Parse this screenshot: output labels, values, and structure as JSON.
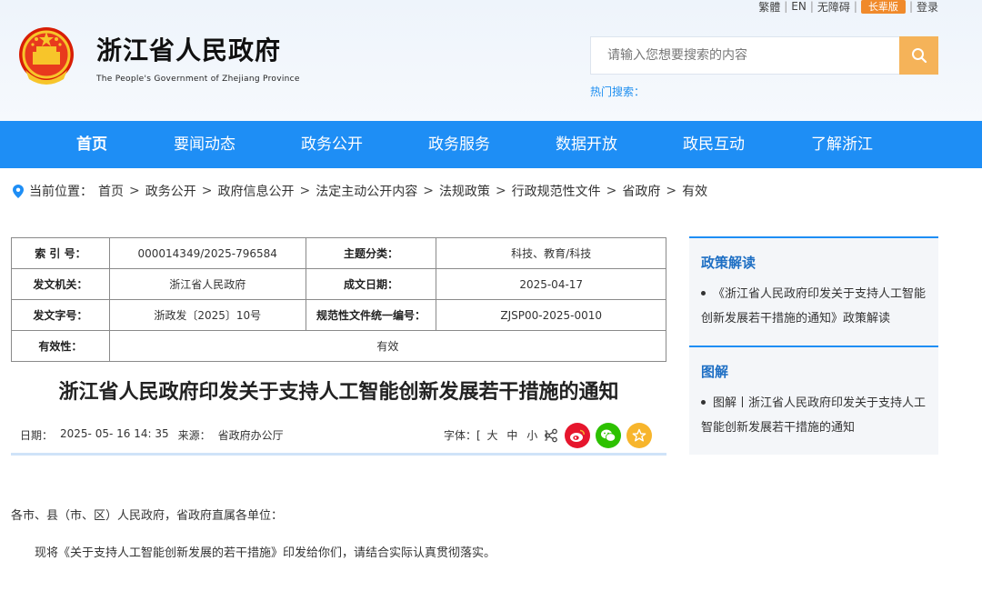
{
  "header": {
    "toplinks": {
      "traditional": "繁體",
      "english": "EN",
      "accessible": "无障碍",
      "elder": "长辈版",
      "login": "登录"
    },
    "site_title": "浙江省人民政府",
    "site_subtitle": "The People's Government of Zhejiang Province",
    "search": {
      "placeholder": "请输入您想要搜索的内容"
    },
    "hot_search": "热门搜索："
  },
  "nav": {
    "items": [
      {
        "label": "首页"
      },
      {
        "label": "要闻动态"
      },
      {
        "label": "政务公开"
      },
      {
        "label": "政务服务"
      },
      {
        "label": "数据开放"
      },
      {
        "label": "政民互动"
      },
      {
        "label": "了解浙江"
      }
    ]
  },
  "breadcrumb": {
    "prefix": "当前位置：",
    "items": [
      "首页",
      "政务公开",
      "政府信息公开",
      "法定主动公开内容",
      "法规政策",
      "行政规范性文件",
      "省政府",
      "有效"
    ],
    "sep": ">"
  },
  "info": {
    "index_label": "索 引 号：",
    "index_value": "000014349/2025-796584",
    "category_label": "主题分类：",
    "category_value": "科技、教育/科技",
    "issuer_label": "发文机关：",
    "issuer_value": "浙江省人民政府",
    "date_label": "成文日期：",
    "date_value": "2025-04-17",
    "docno_label": "发文字号：",
    "docno_value": "浙政发〔2025〕10号",
    "code_label": "规范性文件统一编号：",
    "code_value": "ZJSP00-2025-0010",
    "validity_label": "有效性：",
    "validity_value": "有效"
  },
  "article": {
    "title": "浙江省人民政府印发关于支持人工智能创新发展若干措施的通知",
    "date_label": "日期：",
    "date_value": "2025- 05- 16 14: 35",
    "source_label": "来源：",
    "source_value": "省政府办公厅",
    "font_label": "字体：[",
    "font_large": "大",
    "font_mid": "中",
    "font_small": "小",
    "font_end": "]",
    "p1": "各市、县（市、区）人民政府，省政府直属各单位：",
    "p2": "现将《关于支持人工智能创新发展的若干措施》印发给你们，请结合实际认真贯彻落实。"
  },
  "sidebar": {
    "policy": {
      "heading": "政策解读",
      "item_line1": "《浙江省人民政府印发关于支持人工智能",
      "item_line2": "创新发展若干措施的通知》政策解读"
    },
    "graphic": {
      "heading": "图解",
      "item_line1": "图解丨浙江省人民政府印发关于支持人工",
      "item_line2": "智能创新发展若干措施的通知"
    }
  },
  "colors": {
    "nav": "#1e8ef5",
    "search_button": "#f5b359",
    "elder_badge": "#f08a2b",
    "weibo": "#e6162d",
    "wechat": "#2dc100",
    "favorite": "#f7b52c"
  }
}
